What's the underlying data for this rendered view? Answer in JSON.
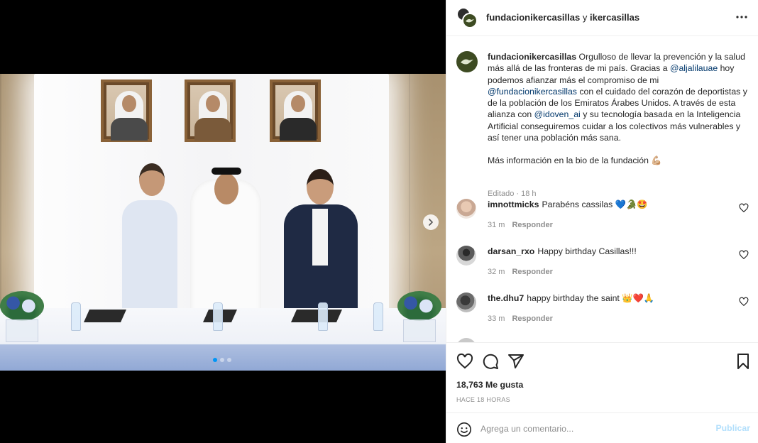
{
  "post": {
    "author": "fundacionikercasillas",
    "connector": "y",
    "coauthor": "ikercasillas",
    "caption": {
      "line1": "Orgulloso de llevar la prevención y la salud más allá de las fronteras de mi país. Gracias a ",
      "mention1": "@aljalilauae",
      "line2": " hoy podemos afianzar más el compromiso de mi ",
      "mention2": "@fundacionikercasillas",
      "line3": " con el cuidado del corazón de deportistas y de la población de los Emiratos Árabes Unidos. A través de esta alianza con ",
      "mention3": "@idoven_ai",
      "line4": " y su tecnología basada en la Inteligencia Artificial conseguiremos cuidar a los colectivos más vulnerables y  así tener una población más sana.",
      "para2": "Más información en la bio de la fundación 💪🏼",
      "meta": "Editado · 18 h"
    },
    "comments": [
      {
        "user": "imnottmicks",
        "text": "Parabéns cassilas 💙🐊🤩",
        "age": "31 m",
        "reply": "Responder"
      },
      {
        "user": "darsan_rxo",
        "text": "Happy birthday Casillas!!!",
        "age": "32 m",
        "reply": "Responder"
      },
      {
        "user": "the.dhu7",
        "text": "happy birthday the saint 👑❤️🙏",
        "age": "33 m",
        "reply": "Responder"
      }
    ],
    "likes": "18,763 Me gusta",
    "posted": "HACE 18 HORAS",
    "comment_box": {
      "placeholder": "Agrega un comentario...",
      "submit": "Publicar"
    },
    "carousel": {
      "count": 3,
      "active": 1
    }
  },
  "icons": {
    "more": "more-horizontal-icon",
    "next": "chevron-right-icon",
    "like": "heart-icon",
    "comment": "comment-icon",
    "share": "send-icon",
    "save": "bookmark-icon",
    "emoji": "emoji-icon"
  },
  "colors": {
    "link": "#00376b",
    "muted": "#8e8e8e",
    "post_button": "#b2dffc",
    "carousel_active": "#0095f6"
  }
}
